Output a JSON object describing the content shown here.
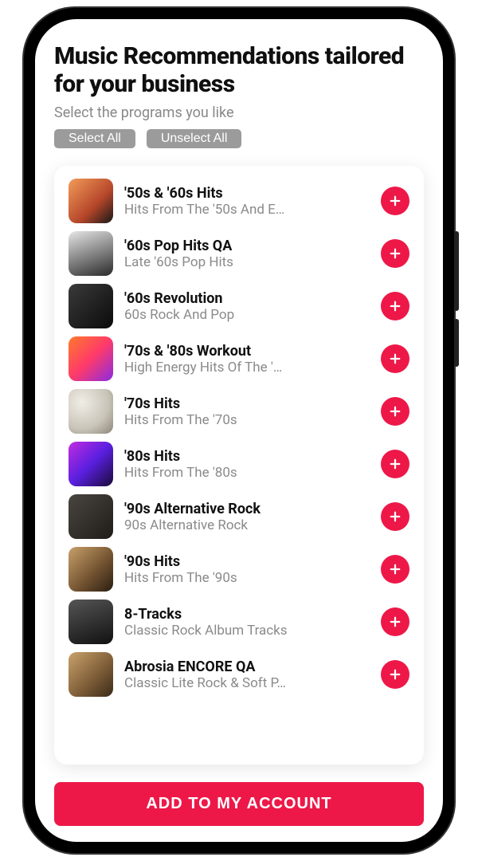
{
  "header": {
    "title": "Music Recommendations tailored for your business",
    "subtitle": "Select the programs you like",
    "select_all": "Select All",
    "unselect_all": "Unselect All"
  },
  "programs": [
    {
      "title": "'50s & '60s Hits",
      "subtitle": "Hits From The '50s And E…",
      "thumb_class": "g0"
    },
    {
      "title": "'60s Pop Hits QA",
      "subtitle": "Late '60s Pop Hits",
      "thumb_class": "g1"
    },
    {
      "title": "'60s Revolution",
      "subtitle": "60s Rock And Pop",
      "thumb_class": "g2"
    },
    {
      "title": "'70s & '80s Workout",
      "subtitle": "High Energy Hits Of The '…",
      "thumb_class": "g3"
    },
    {
      "title": "'70s Hits",
      "subtitle": "Hits From The '70s",
      "thumb_class": "g4"
    },
    {
      "title": "'80s Hits",
      "subtitle": "Hits From The '80s",
      "thumb_class": "g5"
    },
    {
      "title": "'90s Alternative Rock",
      "subtitle": "90s Alternative Rock",
      "thumb_class": "g6"
    },
    {
      "title": "'90s Hits",
      "subtitle": "Hits From The '90s",
      "thumb_class": "g7"
    },
    {
      "title": "8-Tracks",
      "subtitle": "Classic Rock Album Tracks",
      "thumb_class": "g8"
    },
    {
      "title": "Abrosia ENCORE QA",
      "subtitle": "Classic Lite Rock & Soft P…",
      "thumb_class": "g9"
    }
  ],
  "cta": {
    "label": "ADD TO MY ACCOUNT"
  }
}
